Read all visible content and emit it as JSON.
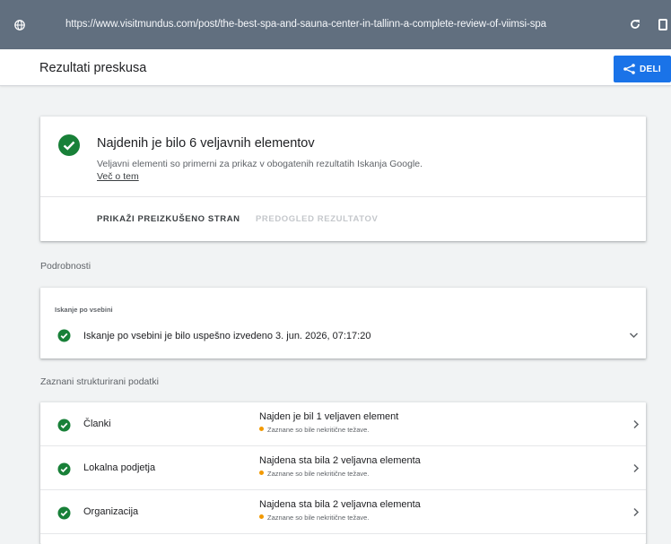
{
  "browser": {
    "url": "https://www.visitmundus.com/post/the-best-spa-and-sauna-center-in-tallinn-a-complete-review-of-viimsi-spa",
    "icons": [
      "globe-icon",
      "reload-icon",
      "tabs-icon"
    ]
  },
  "header": {
    "title": "Rezultati preskusa",
    "share_label": "DELI"
  },
  "summary": {
    "headline": "Najdenih je bilo 6 veljavnih elementov",
    "description": "Veljavni elementi so primerni za prikaz v obogatenih rezultatih Iskanja Google.",
    "more_link": "Več o tem",
    "action_view_page": "PRIKAŽI PREIZKUŠENO STRAN",
    "action_preview": "PREDOGLED REZULTATOV"
  },
  "details": {
    "section_label": "Podrobnosti",
    "crawl_subheading": "Iskanje po vsebini",
    "crawl_text": "Iskanje po vsebini je bilo uspešno izvedeno 3. jun. 2026, 07:17:20"
  },
  "structured_data": {
    "section_label": "Zaznani strukturirani podatki",
    "rows": [
      {
        "name": "Članki",
        "status": "Najden je bil 1 veljaven element",
        "note": "Zaznane so bile nekritične težave."
      },
      {
        "name": "Lokalna podjetja",
        "status": "Najdena sta bila 2 veljavna elementa",
        "note": "Zaznane so bile nekritične težave."
      },
      {
        "name": "Organizacija",
        "status": "Najdena sta bila 2 veljavna elementa",
        "note": "Zaznane so bile nekritične težave."
      }
    ]
  },
  "colors": {
    "accent": "#1a73e8",
    "success": "#188038",
    "warning": "#f29900",
    "browser_bar": "#616f7f"
  }
}
